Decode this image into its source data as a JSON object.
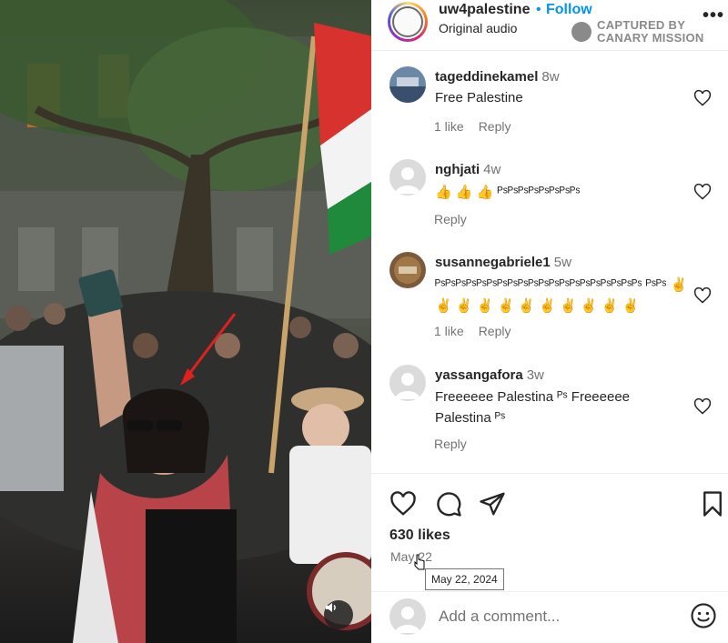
{
  "post": {
    "username": "uw4palestine",
    "separator": "•",
    "follow_label": "Follow",
    "audio": "Original audio",
    "more_icon": "more-horizontal-icon",
    "watermark": {
      "line1": "CAPTURED BY",
      "line2": "CANARY MISSION"
    }
  },
  "comments": [
    {
      "username": "tageddinekamel",
      "time": "8w",
      "text": "Free Palestine",
      "likes": "1 like",
      "reply": "Reply"
    },
    {
      "username": "nghjati",
      "time": "4w",
      "text": "👍 👍 👍 ᴾˢᴾˢᴾˢᴾˢᴾˢᴾˢᴾˢᴾˢ",
      "likes": "",
      "reply": "Reply"
    },
    {
      "username": "susannegabriele1",
      "time": "5w",
      "text": "ᴾˢᴾˢᴾˢᴾˢᴾˢᴾˢᴾˢᴾˢᴾˢᴾˢᴾˢᴾˢᴾˢᴾˢᴾˢᴾˢᴾˢᴾˢᴾˢᴾˢ ᴾˢᴾˢ ✌️ ✌️ ✌️ ✌️ ✌️ ✌️ ✌️ ✌️ ✌️ ✌️ ✌️",
      "likes": "1 like",
      "reply": "Reply"
    },
    {
      "username": "yassangafora",
      "time": "3w",
      "text": "Freeeeee Palestina ᴾˢ Freeeeee Palestina ᴾˢ",
      "likes": "",
      "reply": "Reply"
    }
  ],
  "actions": {
    "likes": "630 likes",
    "date": "May 22",
    "tooltip": "May 22, 2024"
  },
  "add_comment": {
    "placeholder": "Add a comment..."
  },
  "colors": {
    "link": "#0095f6",
    "text": "#262626",
    "muted": "#737373",
    "flag_red": "#d8322e",
    "flag_green": "#1f8a3b"
  }
}
